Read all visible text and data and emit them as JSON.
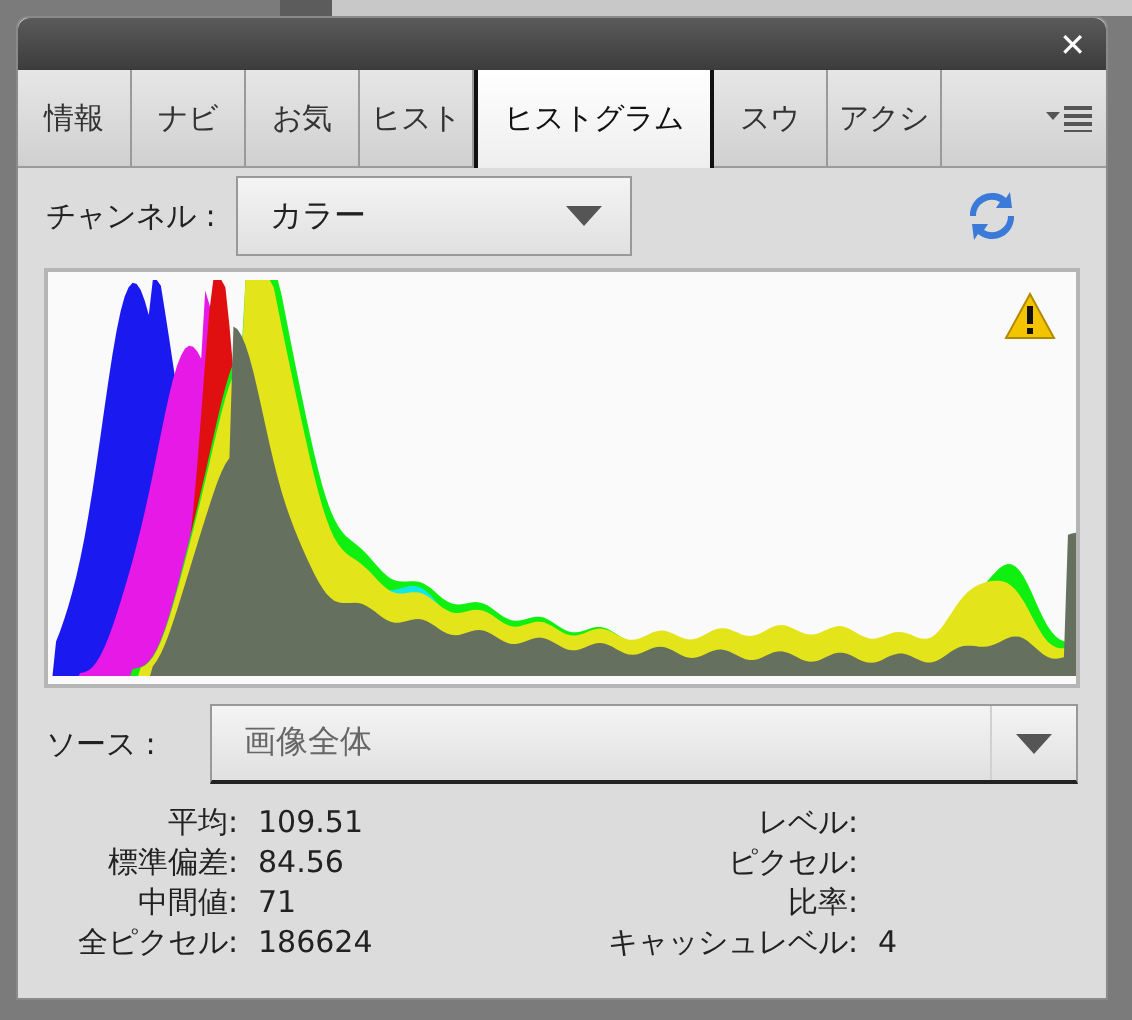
{
  "window": {
    "close": "✕"
  },
  "tabs": [
    {
      "label": "情報",
      "selected": false
    },
    {
      "label": "ナビ",
      "selected": false
    },
    {
      "label": "お気",
      "selected": false
    },
    {
      "label": "ヒスト",
      "selected": false
    },
    {
      "label": "ヒストグラム",
      "selected": true
    },
    {
      "label": "スウ",
      "selected": false
    },
    {
      "label": "アクシ",
      "selected": false
    }
  ],
  "channel": {
    "label": "チャンネル :",
    "value": "カラー"
  },
  "source": {
    "label": "ソース :",
    "value": "画像全体"
  },
  "stats_left": [
    {
      "label": "平均:",
      "value": "109.51"
    },
    {
      "label": "標準偏差:",
      "value": "84.56"
    },
    {
      "label": "中間値:",
      "value": "71"
    },
    {
      "label": "全ピクセル:",
      "value": "186624"
    }
  ],
  "stats_right": [
    {
      "label": "レベル:"
    },
    {
      "label": "ピクセル:"
    },
    {
      "label": "比率:"
    },
    {
      "label": "キャッシュレベル:",
      "value": "4"
    }
  ]
}
